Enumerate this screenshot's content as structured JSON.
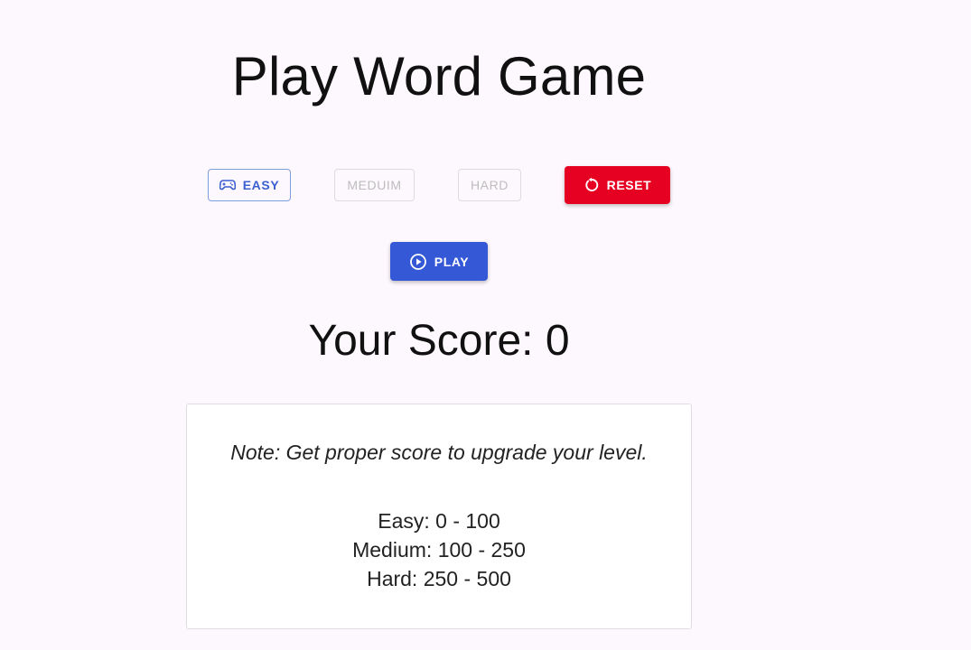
{
  "title": "Play Word Game",
  "levels_buttons": {
    "easy": {
      "label": "EASY",
      "icon": "gamepad-icon",
      "state": "selected"
    },
    "medium": {
      "label": "MEDUIM",
      "state": "disabled"
    },
    "hard": {
      "label": "HARD",
      "state": "disabled"
    }
  },
  "reset": {
    "label": "RESET",
    "icon": "reset-icon"
  },
  "play": {
    "label": "PLAY",
    "icon": "play-circle-icon"
  },
  "score": {
    "text": "Your Score: 0"
  },
  "note": {
    "text": "Note: Get proper score to upgrade your level.",
    "levels": [
      "Easy: 0 - 100",
      "Medium: 100 - 250",
      "Hard: 250 - 500"
    ]
  },
  "colors": {
    "background": "#fdf8fd",
    "primary": "#3558d6",
    "danger": "#e60022",
    "disabled": "#bdbdbd"
  }
}
